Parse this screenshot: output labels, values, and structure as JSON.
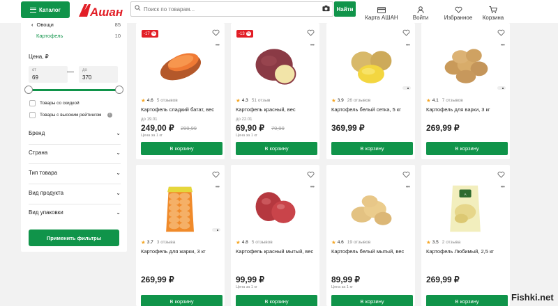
{
  "header": {
    "catalog_label": "Каталог",
    "logo_text": "Ашан",
    "search_placeholder": "Поиск по товарам...",
    "search_button": "Найти",
    "nav": [
      "Карта АШАН",
      "Войти",
      "Избранное",
      "Корзина"
    ],
    "brand_color": "#10944a",
    "logo_color": "#e21e26"
  },
  "sidebar": {
    "categories": [
      {
        "label": "Овощи",
        "count": "85"
      },
      {
        "label": "Картофель",
        "count": "10"
      }
    ],
    "price_label": "Цена, ₽",
    "price_from_label": "от",
    "price_from": "69",
    "price_to_label": "до",
    "price_to": "370",
    "checkboxes": [
      "Товары со скидкой",
      "Товары с высоким рейтингом"
    ],
    "filters": [
      "Бренд",
      "Страна",
      "Тип товара",
      "Вид продукта",
      "Вид упаковки"
    ],
    "apply_button": "Применить фильтры"
  },
  "buy_label": "В корзину",
  "unit_label": "Цена за 1 кг",
  "products": [
    {
      "badge": "-17",
      "rating": "4.6",
      "reviews": "5 отзывов",
      "name": "Картофель сладкий батат, вес",
      "until": "до 19.01",
      "price": "249,00 ₽",
      "old_price": "299,99",
      "unit": "Цена за 1 кг",
      "image": "sweet-potato"
    },
    {
      "badge": "-13",
      "rating": "4.3",
      "reviews": "51 отзыв",
      "name": "Картофель красный, вес",
      "until": "до 22.01",
      "price": "69,90 ₽",
      "old_price": "79,99",
      "unit": "Цена за 1 кг",
      "image": "red-potato"
    },
    {
      "badge": "",
      "rating": "3.9",
      "reviews": "26 отзывов",
      "name": "Картофель белый сетка, 5 кг",
      "until": "",
      "price": "369,99 ₽",
      "old_price": "",
      "unit": "",
      "image": "white-potato"
    },
    {
      "badge": "",
      "rating": "4.1",
      "reviews": "7 отзывов",
      "name": "Картофель для варки, 3 кг",
      "until": "",
      "price": "269,99 ₽",
      "old_price": "",
      "unit": "",
      "image": "potato-pile"
    },
    {
      "badge": "",
      "rating": "3.7",
      "reviews": "3 отзыва",
      "name": "Картофель для жарки, 3 кг",
      "until": "",
      "price": "269,99 ₽",
      "old_price": "",
      "unit": "",
      "image": "potato-bag"
    },
    {
      "badge": "",
      "rating": "4.8",
      "reviews": "5 отзывов",
      "name": "Картофель красный мытый, вес",
      "until": "",
      "price": "99,99 ₽",
      "old_price": "",
      "unit": "Цена за 1 кг",
      "image": "red-washed-potato"
    },
    {
      "badge": "",
      "rating": "4.6",
      "reviews": "19 отзывов",
      "name": "Картофель белый мытый, вес",
      "until": "",
      "price": "89,99 ₽",
      "old_price": "",
      "unit": "Цена за 1 кг",
      "image": "white-washed-potato"
    },
    {
      "badge": "",
      "rating": "3.5",
      "reviews": "2 отзыва",
      "name": "Картофель Любимый, 2,5 кг",
      "until": "",
      "price": "269,99 ₽",
      "old_price": "",
      "unit": "",
      "image": "potato-pack"
    }
  ],
  "watermark": "Fishki.net"
}
